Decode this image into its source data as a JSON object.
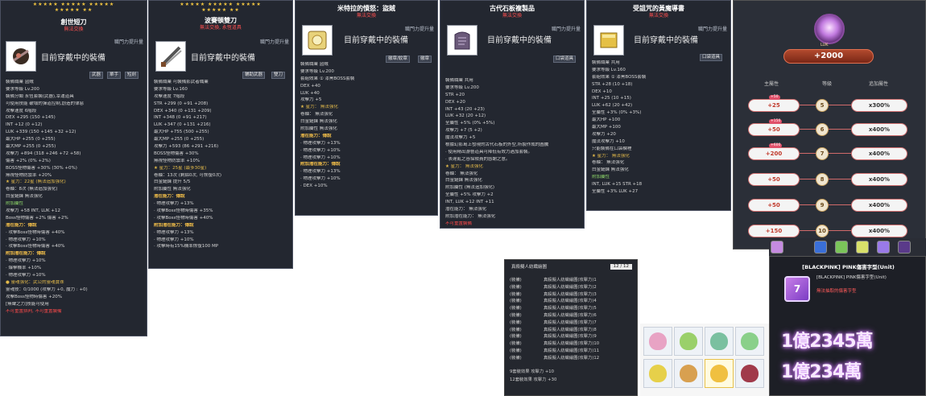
{
  "panel1": {
    "stars": [
      "★★★★★ ★★★★★ ★★★★★",
      "★★★★★ ★★"
    ],
    "title": "創世短刀",
    "subtitle": "無法交換",
    "stat_head": "職門力提升量",
    "equipped": "目前穿戴中的裝備",
    "tags": [
      "武器",
      "單手",
      "短劍"
    ],
    "lines": [
      {
        "t": "裝備職業              盜賊",
        "c": ""
      },
      {
        "t": "要求等級              Lv.200",
        "c": ""
      },
      {
        "t": "裝備分類    永恆套裝(武器),幸運道具",
        "c": ""
      },
      {
        "t": "可使用技能  破壞的彈道控制,創造的律惡",
        "c": ""
      },
      {
        "t": "攻擊速度    6階段",
        "c": ""
      },
      {
        "t": "DEX  +295 (150 +145)",
        "c": ""
      },
      {
        "t": "INT  +12 (0 +12)",
        "c": ""
      },
      {
        "t": "LUK  +339 (150 +145 +32 +12)",
        "c": ""
      },
      {
        "t": "最大HP  +255 (0 +255)",
        "c": ""
      },
      {
        "t": "最大MP  +255 (0 +255)",
        "c": ""
      },
      {
        "t": "攻擊力  +894 (318 +246 +72 +58)",
        "c": ""
      },
      {
        "t": "傷害  +2% (0% +2%)",
        "c": ""
      },
      {
        "t": "BOSS怪物傷害  +30% (30% +0%)",
        "c": ""
      },
      {
        "t": "無視怪物防禦率  +20%",
        "c": ""
      },
      {
        "t": "★ 星力：22星 (無法追加強化)",
        "c": "gold"
      },
      {
        "t": "卷軸：8次 (無法追加強化)",
        "c": ""
      },
      {
        "t": "白金鎚鍊  無法強化",
        "c": ""
      },
      {
        "t": "附加屬性",
        "c": "grn"
      },
      {
        "t": "攻擊力 +58         INT, LUK  +12",
        "c": ""
      },
      {
        "t": "Boss怪物傷害 +2%    傷害 +2%",
        "c": ""
      },
      {
        "t": "潛在能力：傳說",
        "c": "hd"
      },
      {
        "t": "· 攻擊Boss怪物時傷害 +40%",
        "c": ""
      },
      {
        "t": "· 物理攻擊力 +10%",
        "c": ""
      },
      {
        "t": "· 攻擊Boss怪物時傷害 +40%",
        "c": ""
      },
      {
        "t": "附加潛在能力：傳說",
        "c": "hd"
      },
      {
        "t": "· 物理攻擊力 +10%",
        "c": ""
      },
      {
        "t": "· 爆擊機率 +10%",
        "c": ""
      },
      {
        "t": "· 物理攻擊力 +10%",
        "c": ""
      },
      {
        "t": "● 靈魂強化：武公的靈魂寶珠",
        "c": "gold"
      },
      {
        "t": "靈魂技：0/1000 (攻擊力 +0, 魔力 : +0)",
        "c": ""
      },
      {
        "t": "攻擊Boss怪物時傷害 +20%",
        "c": ""
      },
      {
        "t": "[無聲之力]技能可使用",
        "c": ""
      },
      {
        "t": "不可重置拼判, 不可重置裝備",
        "c": "red"
      }
    ]
  },
  "panel2": {
    "stars": [
      "★★★★★ ★★★★★ ★★★★★",
      "★★★★★ ★★"
    ],
    "title": "波賽頓雙刀",
    "subtitle": "無法交換, 永恆道具",
    "stat_head": "職門力提升量",
    "equipped": "目前穿戴中的裝備",
    "tags": [
      "輔助武器",
      "雙刀"
    ],
    "lines": [
      {
        "t": "裝備職業     可裝備影武者職業",
        "c": ""
      },
      {
        "t": "要求等級     Lv.160",
        "c": ""
      },
      {
        "t": "攻擊速度     7階段",
        "c": ""
      },
      {
        "t": "STR  +299 (0 +91 +208)",
        "c": ""
      },
      {
        "t": "DEX  +340 (0 +131 +209)",
        "c": ""
      },
      {
        "t": "INT  +348 (0 +91 +217)",
        "c": ""
      },
      {
        "t": "LUK  +347 (0 +131 +216)",
        "c": ""
      },
      {
        "t": "最大HP  +755 (500 +255)",
        "c": ""
      },
      {
        "t": "最大MP  +255 (0 +255)",
        "c": ""
      },
      {
        "t": "攻擊力  +593 (86 +291 +216)",
        "c": ""
      },
      {
        "t": "BOSS怪物傷害  +30%",
        "c": ""
      },
      {
        "t": "無視怪物防禦率  +10%",
        "c": ""
      },
      {
        "t": "★ 星力：25星 (最多30星)",
        "c": "gold"
      },
      {
        "t": "卷軸：13次 (剩餘0次, 可恢復0次)",
        "c": ""
      },
      {
        "t": "白金鎚鍊  提升 5/5",
        "c": ""
      },
      {
        "t": "附加屬性  無法強化",
        "c": ""
      },
      {
        "t": "潛在能力：傳說",
        "c": "hd"
      },
      {
        "t": "· 物理攻擊力 +13%",
        "c": ""
      },
      {
        "t": "· 攻擊Boss怪物時傷害 +35%",
        "c": ""
      },
      {
        "t": "· 攻擊Boss怪物時傷害 +40%",
        "c": ""
      },
      {
        "t": "附加潛在能力：傳說",
        "c": "hd"
      },
      {
        "t": "· 物理攻擊力 +13%",
        "c": ""
      },
      {
        "t": "· 物理攻擊力 +10%",
        "c": ""
      },
      {
        "t": "· 攻擊時有15%機率恢復100 MP",
        "c": ""
      }
    ]
  },
  "panel3": {
    "title": "米特拉的憤怒：盜賊",
    "subtitle": "無法交換",
    "stat_head": "職門力提升量",
    "equipped": "目前穿戴中的裝備",
    "tags": [
      "徽章/紋章",
      "徽章"
    ],
    "lines": [
      {
        "t": "裝備職業          盜賊",
        "c": ""
      },
      {
        "t": "要求等級          Lv.200",
        "c": ""
      },
      {
        "t": "套組效果  ①      漆黑BOSS套裝",
        "c": ""
      },
      {
        "t": "DEX  +40",
        "c": ""
      },
      {
        "t": "LUK  +40",
        "c": ""
      },
      {
        "t": "攻擊力  +5",
        "c": ""
      },
      {
        "t": "★ 星力：  無法強化",
        "c": "gold"
      },
      {
        "t": "卷軸：  無法強化",
        "c": ""
      },
      {
        "t": "白金鎚鍊  無法強化",
        "c": ""
      },
      {
        "t": "附加屬性  無法強化",
        "c": ""
      },
      {
        "t": "潛在能力：傳說",
        "c": "hd"
      },
      {
        "t": "· 物理攻擊力 +13%",
        "c": ""
      },
      {
        "t": "· 物理攻擊力 +10%",
        "c": ""
      },
      {
        "t": "· 物理攻擊力 +10%",
        "c": ""
      },
      {
        "t": "附加潛在能力：傳說",
        "c": "hd"
      },
      {
        "t": "· 物理攻擊力 +13%",
        "c": ""
      },
      {
        "t": "· 物理攻擊力 +10%",
        "c": ""
      },
      {
        "t": "· DEX +10%",
        "c": ""
      }
    ]
  },
  "panel4": {
    "title": "古代石板複製品",
    "subtitle": "無法交換",
    "stat_head": "職門力提升量",
    "equipped": "目前穿戴中的裝備",
    "tags": [
      "口袋道具"
    ],
    "lines": [
      {
        "t": "裝備職業        共用",
        "c": ""
      },
      {
        "t": "要求等級        Lv.200",
        "c": ""
      },
      {
        "t": "STR  +20",
        "c": ""
      },
      {
        "t": "DEX  +20",
        "c": ""
      },
      {
        "t": "INT  +43 (20 +23)",
        "c": ""
      },
      {
        "t": "LUK  +32 (20 +12)",
        "c": ""
      },
      {
        "t": "全屬性  +5% (0% +5%)",
        "c": ""
      },
      {
        "t": "攻擊力  +7 (5 +2)",
        "c": ""
      },
      {
        "t": "魔法攻擊力  +5",
        "c": ""
      },
      {
        "t": "根據幻影島上發現的古代石板的外型,所製作成的圖騰",
        "c": ""
      },
      {
        "t": "· 使用精出游藝道具可降低有效力過加套裝。",
        "c": ""
      },
      {
        "t": "· 表達亂之谷探險員的感謝之意。",
        "c": ""
      },
      {
        "t": "★ 星力：  無法強化",
        "c": "gold"
      },
      {
        "t": "卷軸：  無法強化",
        "c": ""
      },
      {
        "t": "白金鎚鍊  無法強化",
        "c": ""
      },
      {
        "t": "附加屬性 (無法追加強化)",
        "c": ""
      },
      {
        "t": "全屬性 +5%        攻擊力  +2",
        "c": ""
      },
      {
        "t": "INT, LUK  +12     INT  +11",
        "c": ""
      },
      {
        "t": "潛在能力：  無法強化",
        "c": ""
      },
      {
        "t": "附加潛在能力：  無法強化",
        "c": ""
      },
      {
        "t": "不可重置裝備",
        "c": "red"
      }
    ]
  },
  "panel5": {
    "title": "受詛咒的黃魔導書",
    "subtitle": "無法交換",
    "stat_head": "職門力提升量",
    "equipped": "目前穿戴中的裝備",
    "tags": [
      "口袋道具"
    ],
    "lines": [
      {
        "t": "裝備職業        共用",
        "c": ""
      },
      {
        "t": "要求等級        Lv.160",
        "c": ""
      },
      {
        "t": "套組效果  ①   漆黑BOSS套裝",
        "c": ""
      },
      {
        "t": "STR  +28 (10 +18)",
        "c": ""
      },
      {
        "t": "DEX  +10",
        "c": ""
      },
      {
        "t": "INT  +25 (10 +15)",
        "c": ""
      },
      {
        "t": "LUK  +62 (20 +42)",
        "c": ""
      },
      {
        "t": "全屬性  +3% (0% +3%)",
        "c": ""
      },
      {
        "t": "最大HP  +100",
        "c": ""
      },
      {
        "t": "最大MP  +100",
        "c": ""
      },
      {
        "t": "攻擊力  +20",
        "c": ""
      },
      {
        "t": "魔法攻擊力  +10",
        "c": ""
      },
      {
        "t": "只能裝備在口袋欄裡",
        "c": ""
      },
      {
        "t": "★ 星力：  無法強化",
        "c": "gold"
      },
      {
        "t": "卷軸：  無法強化",
        "c": ""
      },
      {
        "t": "白金鎚鍊  無法強化",
        "c": ""
      },
      {
        "t": "附加屬性",
        "c": "grn"
      },
      {
        "t": "INT, LUK  +15      STR  +18",
        "c": ""
      },
      {
        "t": "全屬性  +3%        LUK  +27",
        "c": ""
      }
    ]
  },
  "potential": {
    "luk_tag": "LUK",
    "luk_value": "+2000",
    "head_main": "主屬性",
    "head_level": "等級",
    "head_add": "追加屬性",
    "rows": [
      {
        "main": "+25",
        "bonus": "+50",
        "level": "5",
        "add": "x300%"
      },
      {
        "main": "+50",
        "bonus": "+150",
        "level": "6",
        "add": "x400%"
      },
      {
        "main": "+200",
        "bonus": "+600",
        "level": "7",
        "add": "x400%"
      },
      {
        "main": "+50",
        "bonus": "",
        "level": "8",
        "add": "x400%"
      },
      {
        "main": "+50",
        "bonus": "",
        "level": "9",
        "add": "x400%"
      },
      {
        "main": "+150",
        "bonus": "",
        "level": "10",
        "add": "x400%"
      }
    ]
  },
  "damage_skin": {
    "title": "[BLACKPINK] PINK傷害字型(Unit)",
    "name": "[BLACKPINK] PINK傷害字型(Unit)",
    "note": "無法抽取的傷害字型",
    "big1": "1億2345萬",
    "big2": "1億234萬"
  },
  "list": {
    "title": "真殺擬人紡織繪圖",
    "page": "12 / 12",
    "rows": [
      {
        "a": "(裝備)",
        "b": "真殺擬人紡織繪圖(攻擊力)1"
      },
      {
        "a": "(裝備)",
        "b": "真殺擬人紡織繪圖(攻擊力)2"
      },
      {
        "a": "(裝備)",
        "b": "真殺擬人紡織繪圖(攻擊力)3"
      },
      {
        "a": "(裝備)",
        "b": "真殺擬人紡織繪圖(攻擊力)4"
      },
      {
        "a": "(裝備)",
        "b": "真殺擬人紡織繪圖(攻擊力)5"
      },
      {
        "a": "(裝備)",
        "b": "真殺擬人紡織繪圖(攻擊力)6"
      },
      {
        "a": "(裝備)",
        "b": "真殺擬人紡織繪圖(攻擊力)7"
      },
      {
        "a": "(裝備)",
        "b": "真殺擬人紡織繪圖(攻擊力)8"
      },
      {
        "a": "(裝備)",
        "b": "真殺擬人紡織繪圖(攻擊力)9"
      },
      {
        "a": "(裝備)",
        "b": "真殺擬人紡織繪圖(攻擊力)10"
      },
      {
        "a": "(裝備)",
        "b": "真殺擬人紡織繪圖(攻擊力)11"
      },
      {
        "a": "(裝備)",
        "b": "真殺擬人紡織繪圖(攻擊力)12"
      }
    ],
    "foot1": "9套裝效果      攻擊力 +10",
    "foot2": "12套裝效果     攻擊力 +30"
  },
  "colors": {
    "panel_bg": "#232730",
    "header_gold": "#f7c24a",
    "warn_red": "#ff4a4a",
    "accent_pink": "#d68bff"
  }
}
